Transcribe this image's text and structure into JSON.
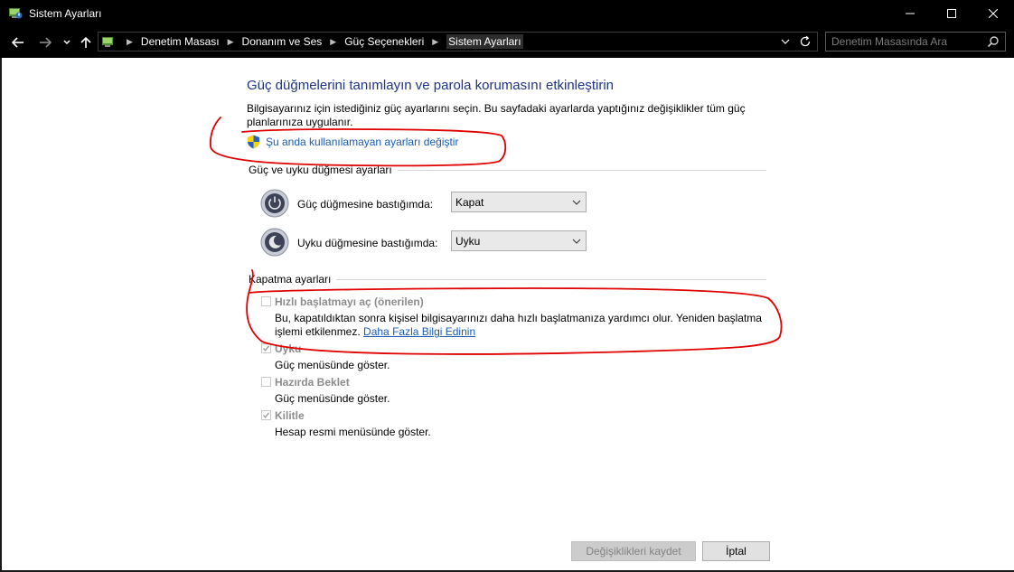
{
  "window": {
    "title": "Sistem Ayarları"
  },
  "breadcrumb": {
    "items": [
      "Denetim Masası",
      "Donanım ve Ses",
      "Güç Seçenekleri",
      "Sistem Ayarları"
    ]
  },
  "search": {
    "placeholder": "Denetim Masasında Ara"
  },
  "page": {
    "title": "Güç düğmelerini tanımlayın ve parola korumasını etkinleştirin",
    "description": "Bilgisayarınız için istediğiniz güç ayarlarını seçin. Bu sayfadaki ayarlarda yaptığınız değişiklikler tüm güç planlarınıza uygulanır.",
    "uac_link": "Şu anda kullanılamayan ayarları değiştir"
  },
  "power_section": {
    "header": "Güç ve uyku düğmesi ayarları",
    "power_button_label": "Güç düğmesine bastığımda:",
    "power_button_value": "Kapat",
    "sleep_button_label": "Uyku düğmesine bastığımda:",
    "sleep_button_value": "Uyku"
  },
  "shutdown_section": {
    "header": "Kapatma ayarları",
    "options": [
      {
        "label": "Hızlı başlatmayı aç (önerilen)",
        "checked": false,
        "desc_line1": "Bu, kapatıldıktan sonra kişisel bilgisayarınızı daha hızlı başlatmanıza yardımcı olur. Yeniden başlatma",
        "desc_line2": "işlemi etkilenmez.",
        "link": "Daha Fazla Bilgi Edinin"
      },
      {
        "label": "Uyku",
        "checked": true,
        "desc": "Güç menüsünde göster."
      },
      {
        "label": "Hazırda Beklet",
        "checked": false,
        "desc": "Güç menüsünde göster."
      },
      {
        "label": "Kilitle",
        "checked": true,
        "desc": "Hesap resmi menüsünde göster."
      }
    ]
  },
  "buttons": {
    "save": "Değişiklikleri kaydet",
    "cancel": "İptal"
  },
  "colors": {
    "title_blue": "#1e3287",
    "link_blue": "#1a5cb5",
    "annotation_red": "#e00000"
  }
}
